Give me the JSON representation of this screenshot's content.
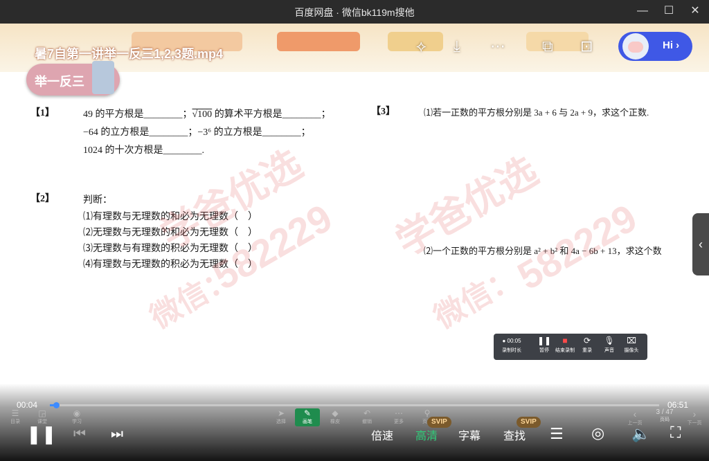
{
  "window": {
    "title": "百度网盘 · 微信bk119m搜他"
  },
  "video": {
    "filename": "暑7自第一讲举一反三1,2,3题.mp4",
    "badge": "举一反三",
    "hi_label": "Hi ›"
  },
  "questions": {
    "q1": {
      "num": "【1】",
      "line1a": "49 的平方根是________；",
      "line1b": "√100",
      "line1c": " 的算术平方根是________；",
      "line2": "−64 的立方根是________；−3⁶ 的立方根是________；",
      "line3": "1024 的十次方根是________."
    },
    "q2": {
      "num": "【2】",
      "intro": "判断：",
      "items": [
        "⑴有理数与无理数的和必为无理数（　）",
        "⑵无理数与无理数的和必为无理数（　）",
        "⑶无理数与有理数的积必为无理数（　）",
        "⑷有理数与无理数的积必为无理数（　）"
      ]
    },
    "q3": {
      "num": "【3】",
      "part1": "⑴若一正数的平方根分别是 3a + 6 与 2a + 9，求这个正数.",
      "part2": "⑵一个正数的平方根分别是 a² + b² 和 4a − 6b + 13，求这个数"
    }
  },
  "watermarks": [
    "学爸优选",
    "微信：",
    "582229"
  ],
  "recorder": {
    "time": "● 00:05",
    "sub": "录制时长",
    "buttons": [
      "暂停",
      "结束录制",
      "重录",
      "声音",
      "摄像头"
    ]
  },
  "player": {
    "current_time": "00:04",
    "duration": "06:51",
    "progress_fraction": 0.01,
    "page_indicator": "3 / 47",
    "strip_labels": [
      "目录",
      "课堂",
      "学习",
      "选择",
      "画笔",
      "橡皮",
      "撤销",
      "更多",
      "页面",
      "上一页",
      "页码",
      "下一页"
    ],
    "controls": {
      "speed": "倍速",
      "quality": "高清",
      "subtitle": "字幕",
      "search": "查找",
      "svip": "SVIP"
    }
  },
  "colors": {
    "accent": "#3d8bff",
    "hi_pill": "#3f58e6",
    "badge": "#dea5b0",
    "quality_active": "#2fd07b"
  }
}
